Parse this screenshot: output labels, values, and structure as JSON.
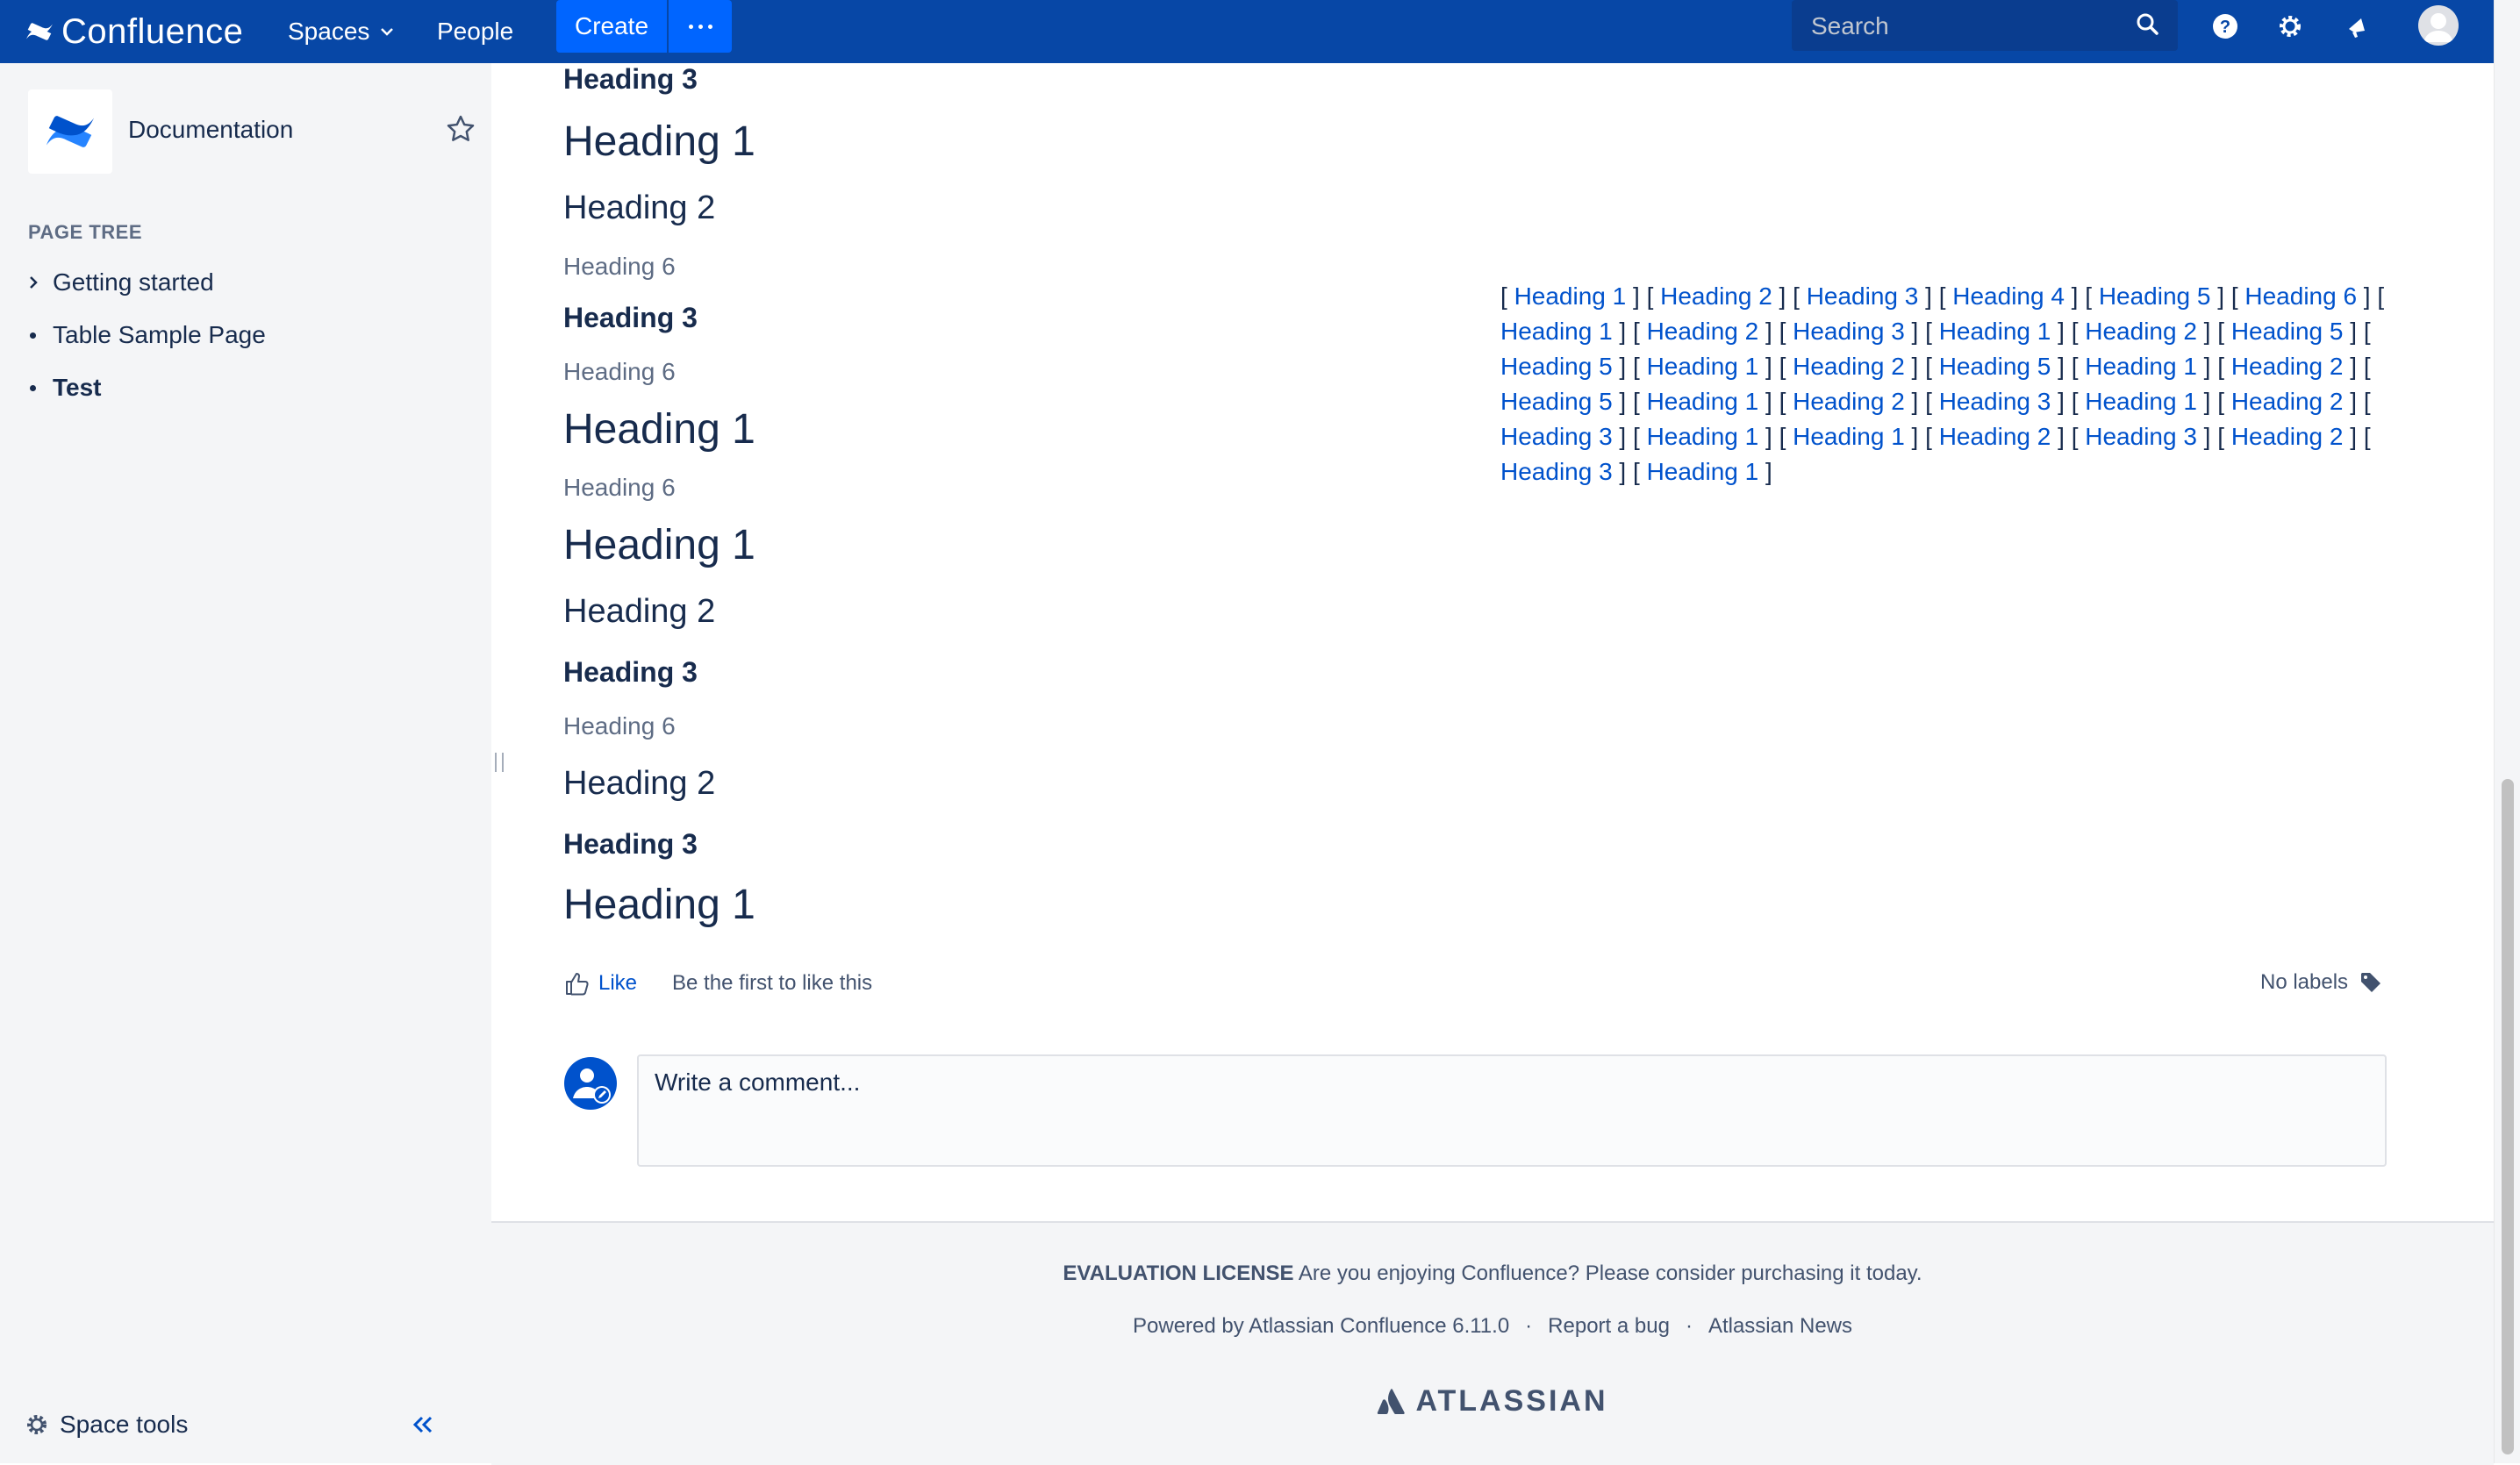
{
  "topnav": {
    "brand": "Confluence",
    "spaces": "Spaces",
    "people": "People",
    "create": "Create",
    "search_placeholder": "Search"
  },
  "sidebar": {
    "space_name": "Documentation",
    "page_tree_heading": "PAGE TREE",
    "tree_items": [
      {
        "label": "Getting started",
        "marker": "chevron-right"
      },
      {
        "label": "Table Sample Page",
        "marker": "bullet"
      },
      {
        "label": "Test",
        "marker": "bullet",
        "current": true
      }
    ],
    "space_tools": "Space tools"
  },
  "content": {
    "headings": [
      {
        "level": 3,
        "text": "Heading 3"
      },
      {
        "level": 1,
        "text": "Heading 1"
      },
      {
        "level": 2,
        "text": "Heading 2"
      },
      {
        "level": 6,
        "text": "Heading 6"
      },
      {
        "level": 3,
        "text": "Heading 3"
      },
      {
        "level": 6,
        "text": "Heading 6"
      },
      {
        "level": 1,
        "text": "Heading 1"
      },
      {
        "level": 6,
        "text": "Heading 6"
      },
      {
        "level": 1,
        "text": "Heading 1"
      },
      {
        "level": 2,
        "text": "Heading 2"
      },
      {
        "level": 3,
        "text": "Heading 3"
      },
      {
        "level": 6,
        "text": "Heading 6"
      },
      {
        "level": 2,
        "text": "Heading 2"
      },
      {
        "level": 3,
        "text": "Heading 3"
      },
      {
        "level": 1,
        "text": "Heading 1"
      }
    ],
    "toc_links": [
      "Heading 1",
      "Heading 2",
      "Heading 3",
      "Heading 4",
      "Heading 5",
      "Heading 6",
      "Heading 1",
      "Heading 2",
      "Heading 3",
      "Heading 1",
      "Heading 2",
      "Heading 5",
      "Heading 5",
      "Heading 1",
      "Heading 2",
      "Heading 5",
      "Heading 1",
      "Heading 2",
      "Heading 5",
      "Heading 1",
      "Heading 2",
      "Heading 3",
      "Heading 1",
      "Heading 2",
      "Heading 3",
      "Heading 1",
      "Heading 1",
      "Heading 2",
      "Heading 3",
      "Heading 2",
      "Heading 3",
      "Heading 1"
    ],
    "like_label": "Like",
    "like_text": "Be the first to like this",
    "labels_text": "No labels",
    "comment_placeholder": "Write a comment..."
  },
  "footer": {
    "license_label": "EVALUATION LICENSE",
    "license_text": "Are you enjoying Confluence? Please consider purchasing it today.",
    "powered_by": "Powered by Atlassian Confluence 6.11.0",
    "report_bug": "Report a bug",
    "atlassian_news": "Atlassian News",
    "atlassian_logo": "ATLASSIAN"
  },
  "colors": {
    "nav_bg": "#0747a6",
    "create_bg": "#0065ff",
    "link": "#0052cc",
    "text": "#172b4d",
    "sidebar_bg": "#f4f5f7"
  }
}
